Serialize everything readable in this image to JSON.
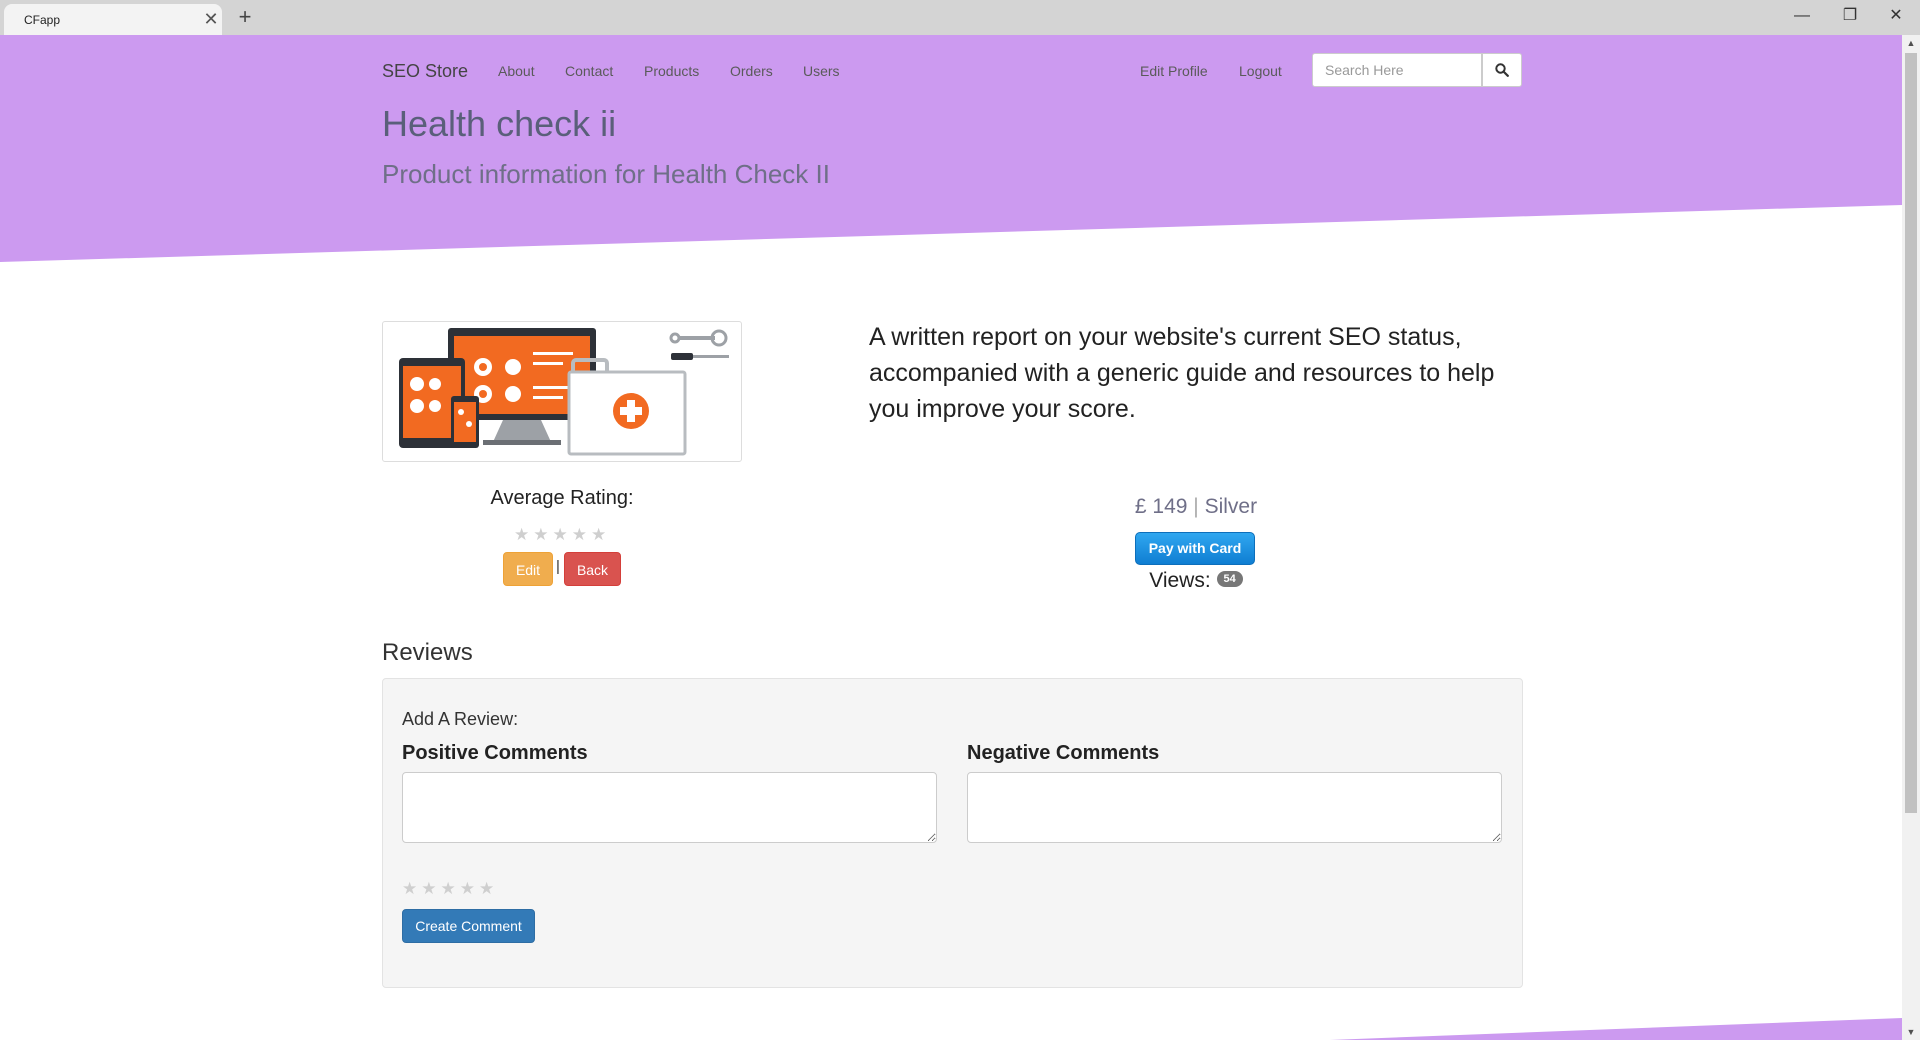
{
  "browser": {
    "tab_title": "CFapp",
    "tab_close": "✕",
    "new_tab": "+",
    "minimize": "—",
    "restore": "❐",
    "close": "✕"
  },
  "navbar": {
    "brand": "SEO Store",
    "links": [
      "About",
      "Contact",
      "Products",
      "Orders",
      "Users"
    ],
    "right_links": [
      "Edit Profile",
      "Logout"
    ],
    "search_placeholder": "Search Here"
  },
  "header": {
    "title": "Health check ii",
    "subtitle": "Product information for Health Check II"
  },
  "product": {
    "average_rating_label": "Average Rating:",
    "rating_stars": [
      "★",
      "★",
      "★",
      "★",
      "★"
    ],
    "edit_label": "Edit",
    "separator": "|",
    "back_label": "Back",
    "description": "A written report on your website's current SEO status, accompanied with a generic guide and resources to help you improve your score.",
    "price": "£ 149",
    "price_separator": "|",
    "tier": "Silver",
    "pay_label": "Pay with Card",
    "views_label": "Views:",
    "views_count": "54"
  },
  "reviews": {
    "title": "Reviews",
    "add_label": "Add A Review:",
    "positive_label": "Positive Comments",
    "negative_label": "Negative Comments",
    "positive_value": "",
    "negative_value": "",
    "rating_stars": [
      "★",
      "★",
      "★",
      "★",
      "★"
    ],
    "create_label": "Create Comment"
  },
  "colors": {
    "hero": "#cc9af0",
    "accent_blue": "#337ab7",
    "edit_orange": "#f0ad4e",
    "back_red": "#d9534f",
    "image_orange": "#f26a21"
  }
}
